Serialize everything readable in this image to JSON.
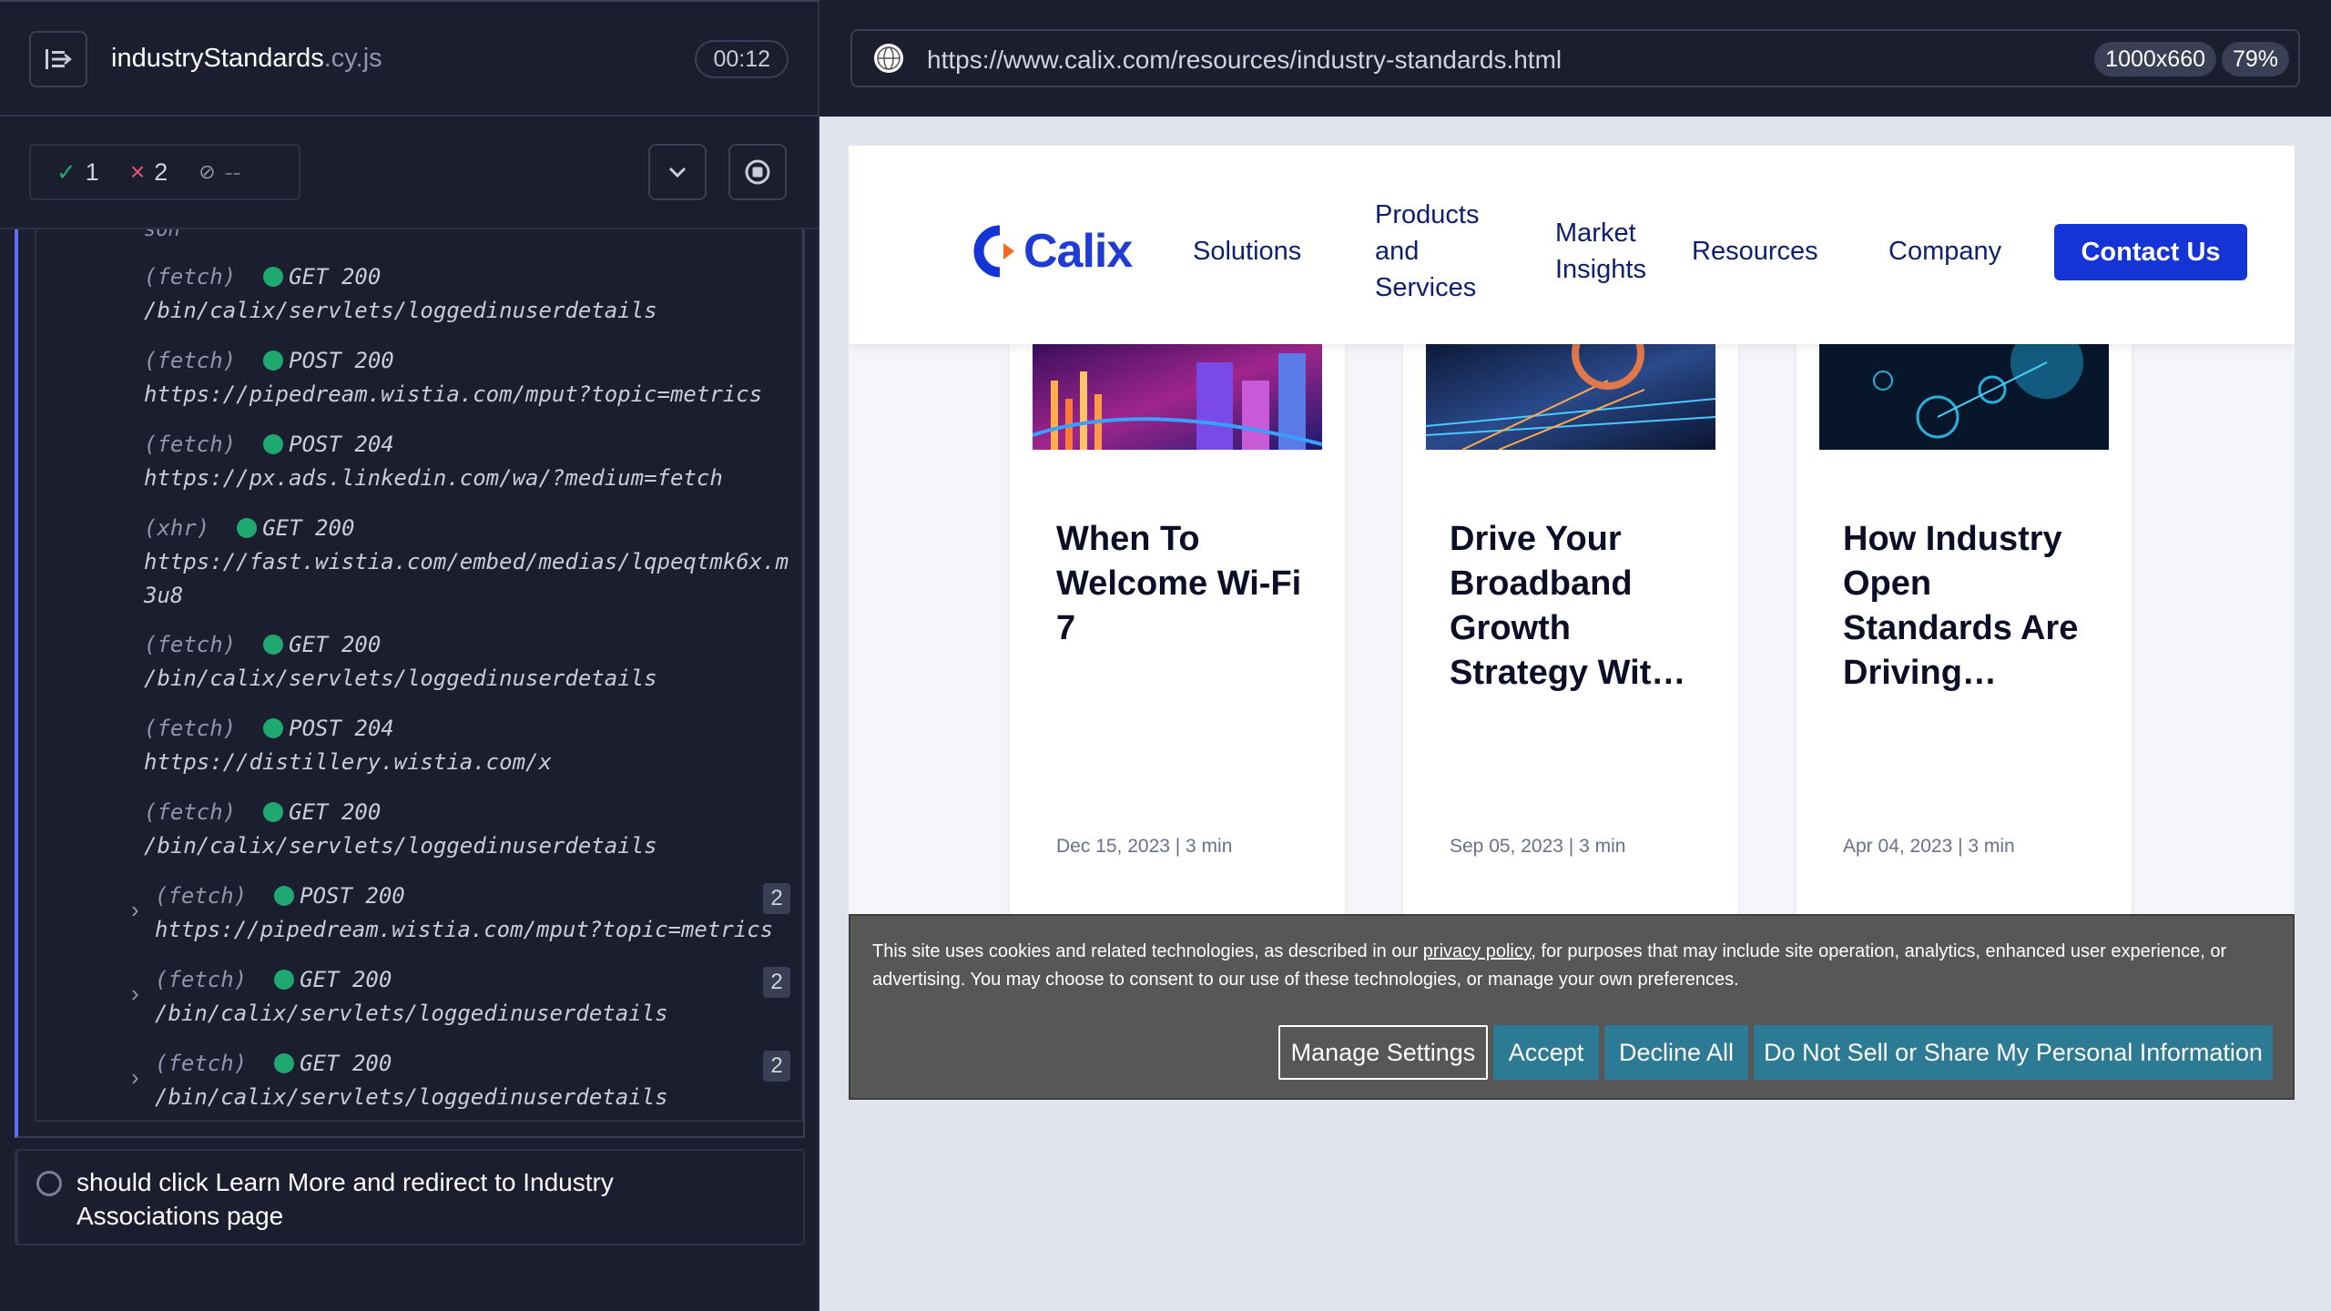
{
  "reporter": {
    "spec_name": "industryStandards",
    "spec_ext": ".cy.js",
    "timer": "00:12",
    "stats": {
      "passed": "1",
      "failed": "2",
      "pending": "--"
    },
    "truncated_text": "son",
    "log_entries": [
      {
        "type": "(fetch)",
        "method": "GET 200",
        "url": "/bin/calix/servlets/loggedinuserdetails"
      },
      {
        "type": "(fetch)",
        "method": "POST 200",
        "url": "https://pipedream.wistia.com/mput?topic=metrics"
      },
      {
        "type": "(fetch)",
        "method": "POST 204",
        "url": "https://px.ads.linkedin.com/wa/?medium=fetch"
      },
      {
        "type": "(xhr)",
        "method": "GET 200",
        "url": "https://fast.wistia.com/embed/medias/lqpeqtmk6x.m3u8"
      },
      {
        "type": "(fetch)",
        "method": "GET 200",
        "url": "/bin/calix/servlets/loggedinuserdetails"
      },
      {
        "type": "(fetch)",
        "method": "POST 204",
        "url": "https://distillery.wistia.com/x"
      },
      {
        "type": "(fetch)",
        "method": "GET 200",
        "url": "/bin/calix/servlets/loggedinuserdetails"
      }
    ],
    "grouped_entries": [
      {
        "type": "(fetch)",
        "method": "POST 200",
        "url": "https://pipedream.wistia.com/mput?topic=metrics",
        "count": "2"
      },
      {
        "type": "(fetch)",
        "method": "GET 200",
        "url": "/bin/calix/servlets/loggedinuserdetails",
        "count": "2"
      },
      {
        "type": "(fetch)",
        "method": "GET 200",
        "url": "/bin/calix/servlets/loggedinuserdetails",
        "count": "2"
      }
    ],
    "test_title": "should click Learn More and redirect to Industry Associations page"
  },
  "aut": {
    "url": "https://www.calix.com/resources/industry-standards.html",
    "viewport_size": "1000x660",
    "zoom": "79%"
  },
  "site": {
    "logo_text": "Calix",
    "nav": {
      "solutions": "Solutions",
      "products_1": "Products",
      "products_2": "and",
      "products_3": "Services",
      "market_1": "Market",
      "market_2": "Insights",
      "resources": "Resources",
      "company": "Company",
      "contact": "Contact Us"
    },
    "cards": [
      {
        "title": "When To Welcome Wi-Fi 7",
        "meta": "Dec 15, 2023 | 3 min"
      },
      {
        "title": "Drive Your Broadband Growth Strategy Wit…",
        "meta": "Sep 05, 2023 | 3 min"
      },
      {
        "title": "How Industry Open Standards Are Driving…",
        "meta": "Apr 04, 2023 | 3 min"
      }
    ],
    "cookie": {
      "text_before": "This site uses cookies and related technologies, as described in our ",
      "link": "privacy policy",
      "text_after": ", for purposes that may include site operation, analytics, enhanced user experience, or advertising. You may choose to consent to our use of these technologies, or manage your own preferences.",
      "manage": "Manage Settings",
      "accept": "Accept",
      "decline": "Decline All",
      "do_not_sell": "Do Not Sell or Share My Personal Information"
    }
  },
  "colors": {
    "accent": "#6470f3",
    "pass": "#1fa971",
    "fail": "#e45770",
    "calix_blue": "#1434d6",
    "calix_orange": "#f26b21"
  }
}
